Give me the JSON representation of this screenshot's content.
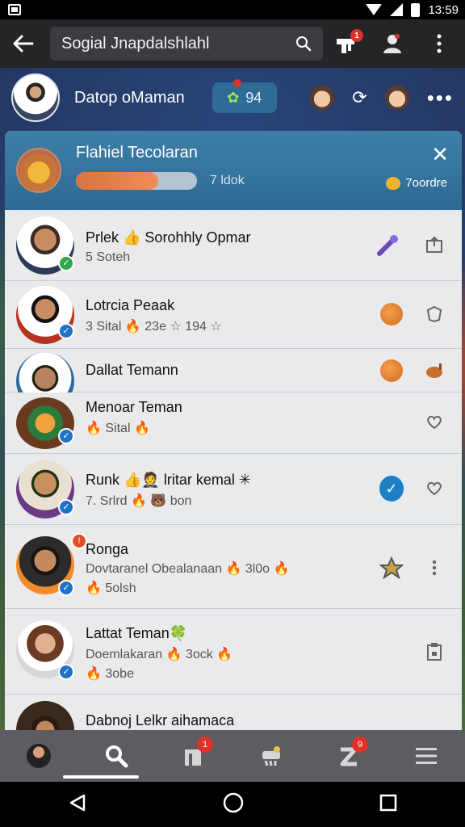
{
  "status_bar": {
    "time": "13:59"
  },
  "app_bar": {
    "search_text": "Sogial Jnapdalshlahl",
    "notification_badge": "1"
  },
  "profile": {
    "name": "Datop oMaman",
    "coin_value": "94"
  },
  "header_card": {
    "title": "Flahiel Tecolaran",
    "progress": 0.68,
    "progress_label": "7 ldok",
    "badge_label": "7oordre"
  },
  "rows": [
    {
      "name": "Prlek 👍 Sorohhly Opmar",
      "sub": "5 Soteh"
    },
    {
      "name": "Lotrcia Peaak",
      "sub": "3 Sital  🔥 23e  ☆ 194 ☆"
    },
    {
      "name": "Dallat Temann",
      "sub": ""
    },
    {
      "name": "Menoar Teman",
      "sub": "🔥 Sital  🔥"
    },
    {
      "name": "Runk 👍🤵 lritar kemal ✳",
      "sub": "7. Srlrd  🔥 🐻 bon"
    },
    {
      "name": "Ronga",
      "sub": "Dovtaranel Obealanaan 🔥 3l0o 🔥",
      "sub2": "🔥 5olsh"
    },
    {
      "name": "Lattat Teman🍀",
      "sub": "Doemlakaran 🔥 3ock 🔥",
      "sub2": "🔥 3obe"
    },
    {
      "name": "Dabnoj Lelkr aihamaca",
      "sub": ""
    }
  ],
  "bottom_nav": {
    "badge_2": "1",
    "badge_4": "9"
  },
  "colors": {
    "accent_blue": "#2d6a93",
    "progress_orange": "#e27a45",
    "badge_red": "#e0302a",
    "check_blue": "#1f7fc4"
  }
}
